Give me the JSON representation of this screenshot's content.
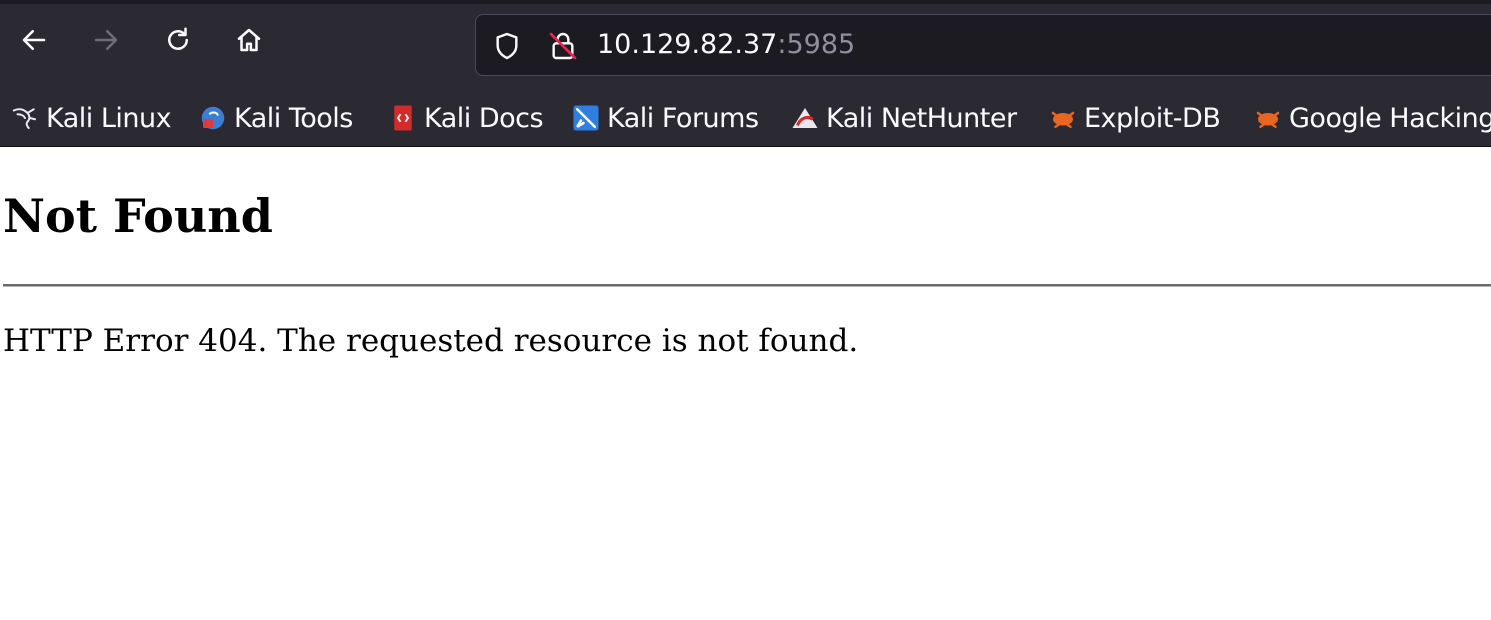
{
  "toolbar": {
    "back_icon": "back-arrow-icon",
    "forward_icon": "forward-arrow-icon",
    "reload_icon": "reload-icon",
    "home_icon": "home-icon"
  },
  "urlbar": {
    "host": "10.129.82.37",
    "port": ":5985",
    "security_icons": [
      "tracking-protection-shield-icon",
      "insecure-lock-icon"
    ]
  },
  "bookmarks": [
    {
      "label": "Kali Linux",
      "icon": "kali-dragon-icon"
    },
    {
      "label": "Kali Tools",
      "icon": "kali-tools-icon"
    },
    {
      "label": "Kali Docs",
      "icon": "kali-docs-icon"
    },
    {
      "label": "Kali Forums",
      "icon": "kali-forums-icon"
    },
    {
      "label": "Kali NetHunter",
      "icon": "kali-nethunter-icon"
    },
    {
      "label": "Exploit-DB",
      "icon": "exploit-db-icon"
    },
    {
      "label": "Google Hacking",
      "icon": "google-hacking-db-icon"
    }
  ],
  "page": {
    "title": "Not Found",
    "message": "HTTP Error 404. The requested resource is not found."
  },
  "colors": {
    "toolbar_bg": "#2b2a33",
    "urlbar_bg": "#1c1b22",
    "text_light": "#fbfbfe",
    "port_text": "#8f8f9d",
    "page_bg": "#ffffff"
  }
}
